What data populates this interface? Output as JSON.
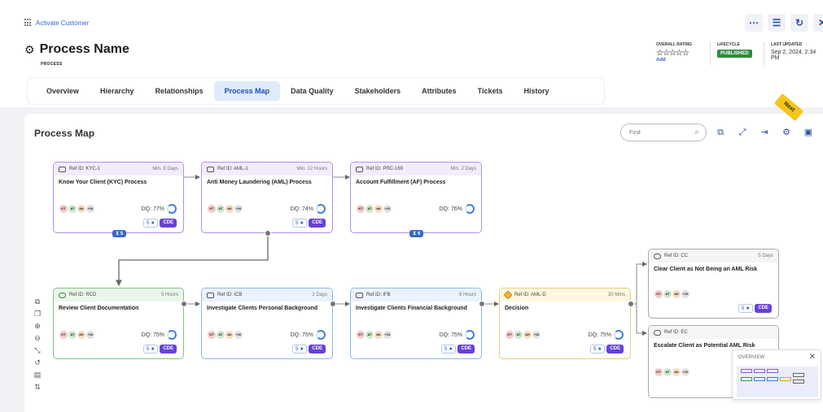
{
  "breadcrumb": "Activate Customer",
  "header": {
    "title": "Process Name",
    "subtitle": "PROCESS",
    "overall_rating_label": "OVERALL RATING",
    "stars": "☆☆☆☆☆",
    "rating_add": "Add",
    "lifecycle_label": "LIFECYCLE",
    "lifecycle_value": "PUBLISHED",
    "last_updated_label": "LAST UPDATED",
    "last_updated_value": "Sep 2, 2024, 2:34 PM"
  },
  "tabs": [
    "Overview",
    "Hierarchy",
    "Relationships",
    "Process Map",
    "Data Quality",
    "Stakeholders",
    "Attributes",
    "Tickets",
    "History"
  ],
  "active_tab": "Process Map",
  "canvas": {
    "title": "Process Map",
    "find_placeholder": "Find",
    "next_badge": "Next"
  },
  "nodes": [
    {
      "ref": "Ref ID: KYC-1",
      "duration": "Min. 8 Days",
      "title": "Know Your Client (KYC) Process",
      "dq": "DQ: 77%",
      "rating": "5 ★",
      "cde": "CDE",
      "chip": "⊻ 5"
    },
    {
      "ref": "Ref ID: AML-1",
      "duration": "Min. 12 Hours",
      "title": "Anti Money Laundering (AML) Process",
      "dq": "DQ: 74%",
      "rating": "5 ★",
      "cde": "CDE"
    },
    {
      "ref": "Ref ID: PRC-169",
      "duration": "Min. 2 Days",
      "title": "Account Fulfillment (AF) Process",
      "dq": "DQ: 76%",
      "chip": "⊻ 6"
    },
    {
      "ref": "Ref ID: RCD",
      "duration": "5 Hours",
      "title": "Review Client Documentation",
      "dq": "DQ: 75%",
      "rating": "5 ★",
      "cde": "CDE"
    },
    {
      "ref": "Ref ID: ICB",
      "duration": "2 Days",
      "title": "Investigate Clients Personal Background",
      "dq": "DQ: 75%",
      "rating": "5 ★",
      "cde": "CDE"
    },
    {
      "ref": "Ref ID: IFB",
      "duration": "6 Hours",
      "title": "Investigate Clients Financial Background",
      "dq": "DQ: 75%",
      "rating": "5 ★",
      "cde": "CDE"
    },
    {
      "ref": "Ref ID: AML-D",
      "duration": "30 Mins",
      "title": "Decision",
      "dq": "DQ: 75%",
      "rating": "5 ★",
      "cde": "CDE"
    },
    {
      "ref": "Ref ID: CC",
      "duration": "5 Days",
      "title": "Clear Client as Not Being an AML Risk",
      "rating": "5 ★",
      "cde": "CDE"
    },
    {
      "ref": "Ref ID: EC",
      "title": "Escalate Client as Potential AML Risk"
    }
  ],
  "avatars": [
    {
      "label": "KT",
      "color": "#f6c9c9"
    },
    {
      "label": "AT",
      "color": "#cfe8cf"
    },
    {
      "label": "AK",
      "color": "#f7dcc0"
    },
    {
      "label": "+10",
      "color": "#e2e2e2"
    }
  ],
  "overview_panel": {
    "label": "OVERVIEW",
    "close": "✕"
  },
  "colors": {
    "accent": "#3566c9",
    "purple_border": "#b48ee6",
    "green_border": "#7cc47f",
    "blue_border": "#8fb7e6",
    "yellow_border": "#e6cf6e",
    "gray_border": "#aaaaaa",
    "cde": "#6741d9",
    "published": "#2e8b3a"
  }
}
